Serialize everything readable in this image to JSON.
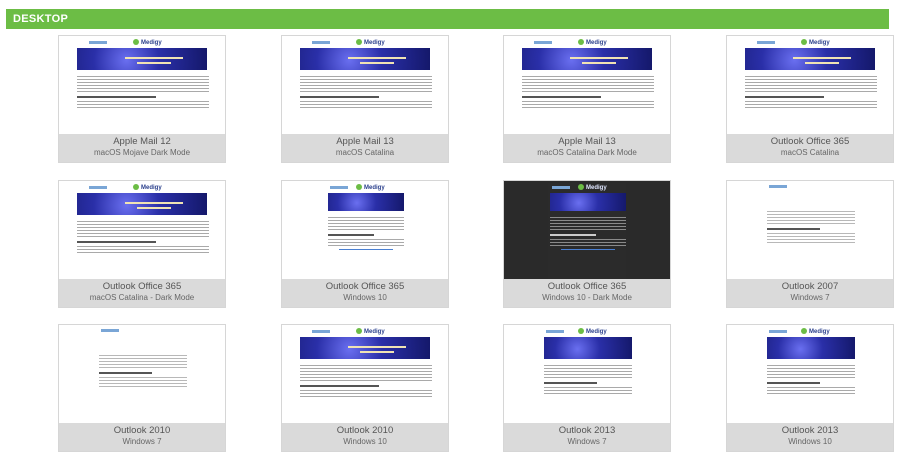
{
  "section": {
    "title": "DESKTOP"
  },
  "previews": [
    {
      "client": "Apple Mail 12",
      "os": "macOS Mojave Dark Mode",
      "style": "rich"
    },
    {
      "client": "Apple Mail 13",
      "os": "macOS Catalina",
      "style": "rich"
    },
    {
      "client": "Apple Mail 13",
      "os": "macOS Catalina Dark Mode",
      "style": "rich"
    },
    {
      "client": "Outlook Office 365",
      "os": "macOS Catalina",
      "style": "rich"
    },
    {
      "client": "Outlook Office 365",
      "os": "macOS Catalina - Dark Mode",
      "style": "rich"
    },
    {
      "client": "Outlook Office 365",
      "os": "Windows 10",
      "style": "rich"
    },
    {
      "client": "Outlook Office 365",
      "os": "Windows 10 - Dark Mode",
      "style": "dark"
    },
    {
      "client": "Outlook 2007",
      "os": "Windows 7",
      "style": "plain"
    },
    {
      "client": "Outlook 2010",
      "os": "Windows 7",
      "style": "plain"
    },
    {
      "client": "Outlook 2010",
      "os": "Windows 10",
      "style": "rich"
    },
    {
      "client": "Outlook 2013",
      "os": "Windows 7",
      "style": "rich"
    },
    {
      "client": "Outlook 2013",
      "os": "Windows 10",
      "style": "rich"
    }
  ],
  "email_preview": {
    "logo_text": "Medigy"
  },
  "colors": {
    "header": "#6cbd45",
    "caption_bg": "#dadada",
    "banner": "#2a2fa8"
  }
}
